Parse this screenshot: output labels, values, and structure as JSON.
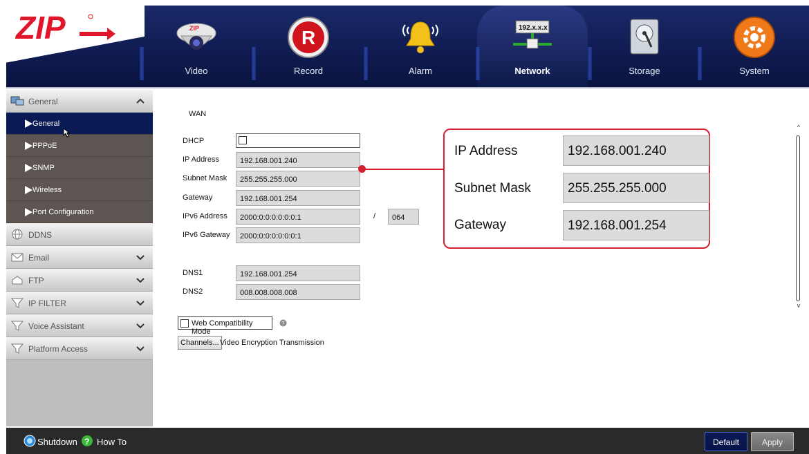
{
  "nav": {
    "items": [
      {
        "label": "Video"
      },
      {
        "label": "Record",
        "badge": "R"
      },
      {
        "label": "Alarm"
      },
      {
        "label": "Network",
        "screen_text": "192.x.x.x"
      },
      {
        "label": "Storage"
      },
      {
        "label": "System"
      }
    ],
    "active": "Network"
  },
  "logo": {
    "text": "ZIP",
    "video_text": "ZIP"
  },
  "sidebar": {
    "sections": [
      {
        "label": "General",
        "icon": "network-computer-icon",
        "expanded": true
      },
      {
        "label": "DDNS",
        "icon": "globe-icon"
      },
      {
        "label": "Email",
        "icon": "envelope-icon"
      },
      {
        "label": "FTP",
        "icon": "ftp-icon"
      },
      {
        "label": "IP FILTER",
        "icon": "funnel-icon"
      },
      {
        "label": "Voice Assistant",
        "icon": "funnel-icon"
      },
      {
        "label": "Platform Access",
        "icon": "funnel-icon"
      }
    ],
    "general_items": [
      {
        "label": "General"
      },
      {
        "label": "PPPoE"
      },
      {
        "label": "SNMP"
      },
      {
        "label": "Wireless"
      },
      {
        "label": "Port Configuration"
      }
    ],
    "selected_item": "General"
  },
  "form": {
    "section_title": "WAN",
    "dhcp_label": "DHCP",
    "dhcp_checked": false,
    "ip_label": "IP Address",
    "ip_value": "192.168.001.240",
    "mask_label": "Subnet Mask",
    "mask_value": "255.255.255.000",
    "gateway_label": "Gateway",
    "gateway_value": "192.168.001.254",
    "ipv6_label": "IPv6 Address",
    "ipv6_value": "2000:0:0:0:0:0:0:1",
    "ipv6_sep": "/",
    "ipv6_prefix": "064",
    "ipv6_gw_label": "IPv6 Gateway",
    "ipv6_gw_value": "2000:0:0:0:0:0:0:1",
    "dns1_label": "DNS1",
    "dns1_value": "192.168.001.254",
    "dns2_label": "DNS2",
    "dns2_value": "008.008.008.008",
    "web_compat_label": "Web Compatibility Mode",
    "channels_btn": "Channels...",
    "encryption_label": "Video Encryption Transmission"
  },
  "callout": {
    "ip_label": "IP Address",
    "ip_value": "192.168.001.240",
    "mask_label": "Subnet Mask",
    "mask_value": "255.255.255.000",
    "gateway_label": "Gateway",
    "gateway_value": "192.168.001.254",
    "accent": "#d32030"
  },
  "bottom": {
    "shutdown": "Shutdown",
    "howto": "How To",
    "default_btn": "Default",
    "apply_btn": "Apply"
  }
}
